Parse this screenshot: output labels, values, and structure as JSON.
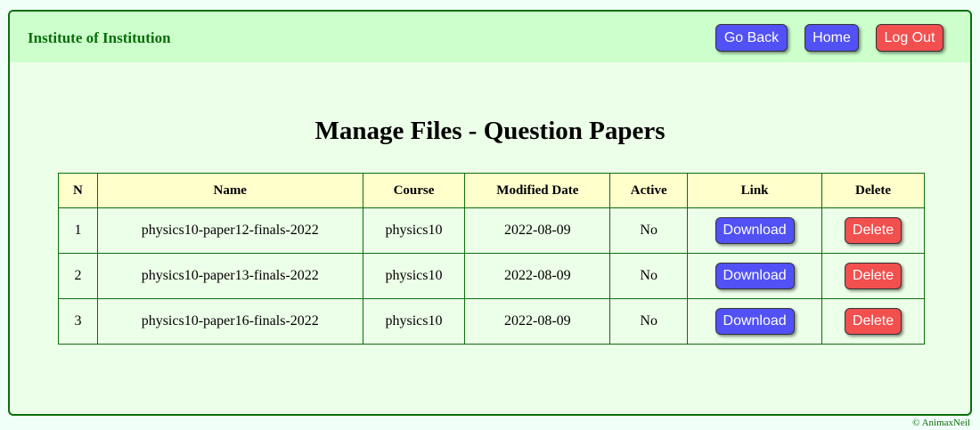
{
  "header": {
    "brand": "Institute of Institution",
    "go_back_label": "Go Back",
    "home_label": "Home",
    "logout_label": "Log Out"
  },
  "page": {
    "title": "Manage Files - Question Papers"
  },
  "table": {
    "columns": [
      "N",
      "Name",
      "Course",
      "Modified Date",
      "Active",
      "Link",
      "Delete"
    ],
    "rows": [
      {
        "n": "1",
        "name": "physics10-paper12-finals-2022",
        "course": "physics10",
        "date": "2022-08-09",
        "active": "No",
        "link_label": "Download",
        "delete_label": "Delete"
      },
      {
        "n": "2",
        "name": "physics10-paper13-finals-2022",
        "course": "physics10",
        "date": "2022-08-09",
        "active": "No",
        "link_label": "Download",
        "delete_label": "Delete"
      },
      {
        "n": "3",
        "name": "physics10-paper16-finals-2022",
        "course": "physics10",
        "date": "2022-08-09",
        "active": "No",
        "link_label": "Download",
        "delete_label": "Delete"
      }
    ]
  },
  "footer": {
    "text": "© AnimaxNeil"
  },
  "colors": {
    "accent_green": "#0b6e0b",
    "header_bg": "#ccffcc",
    "button_blue": "#5151f5",
    "button_red": "#f24f4f",
    "table_header_bg": "#ffffcc"
  }
}
